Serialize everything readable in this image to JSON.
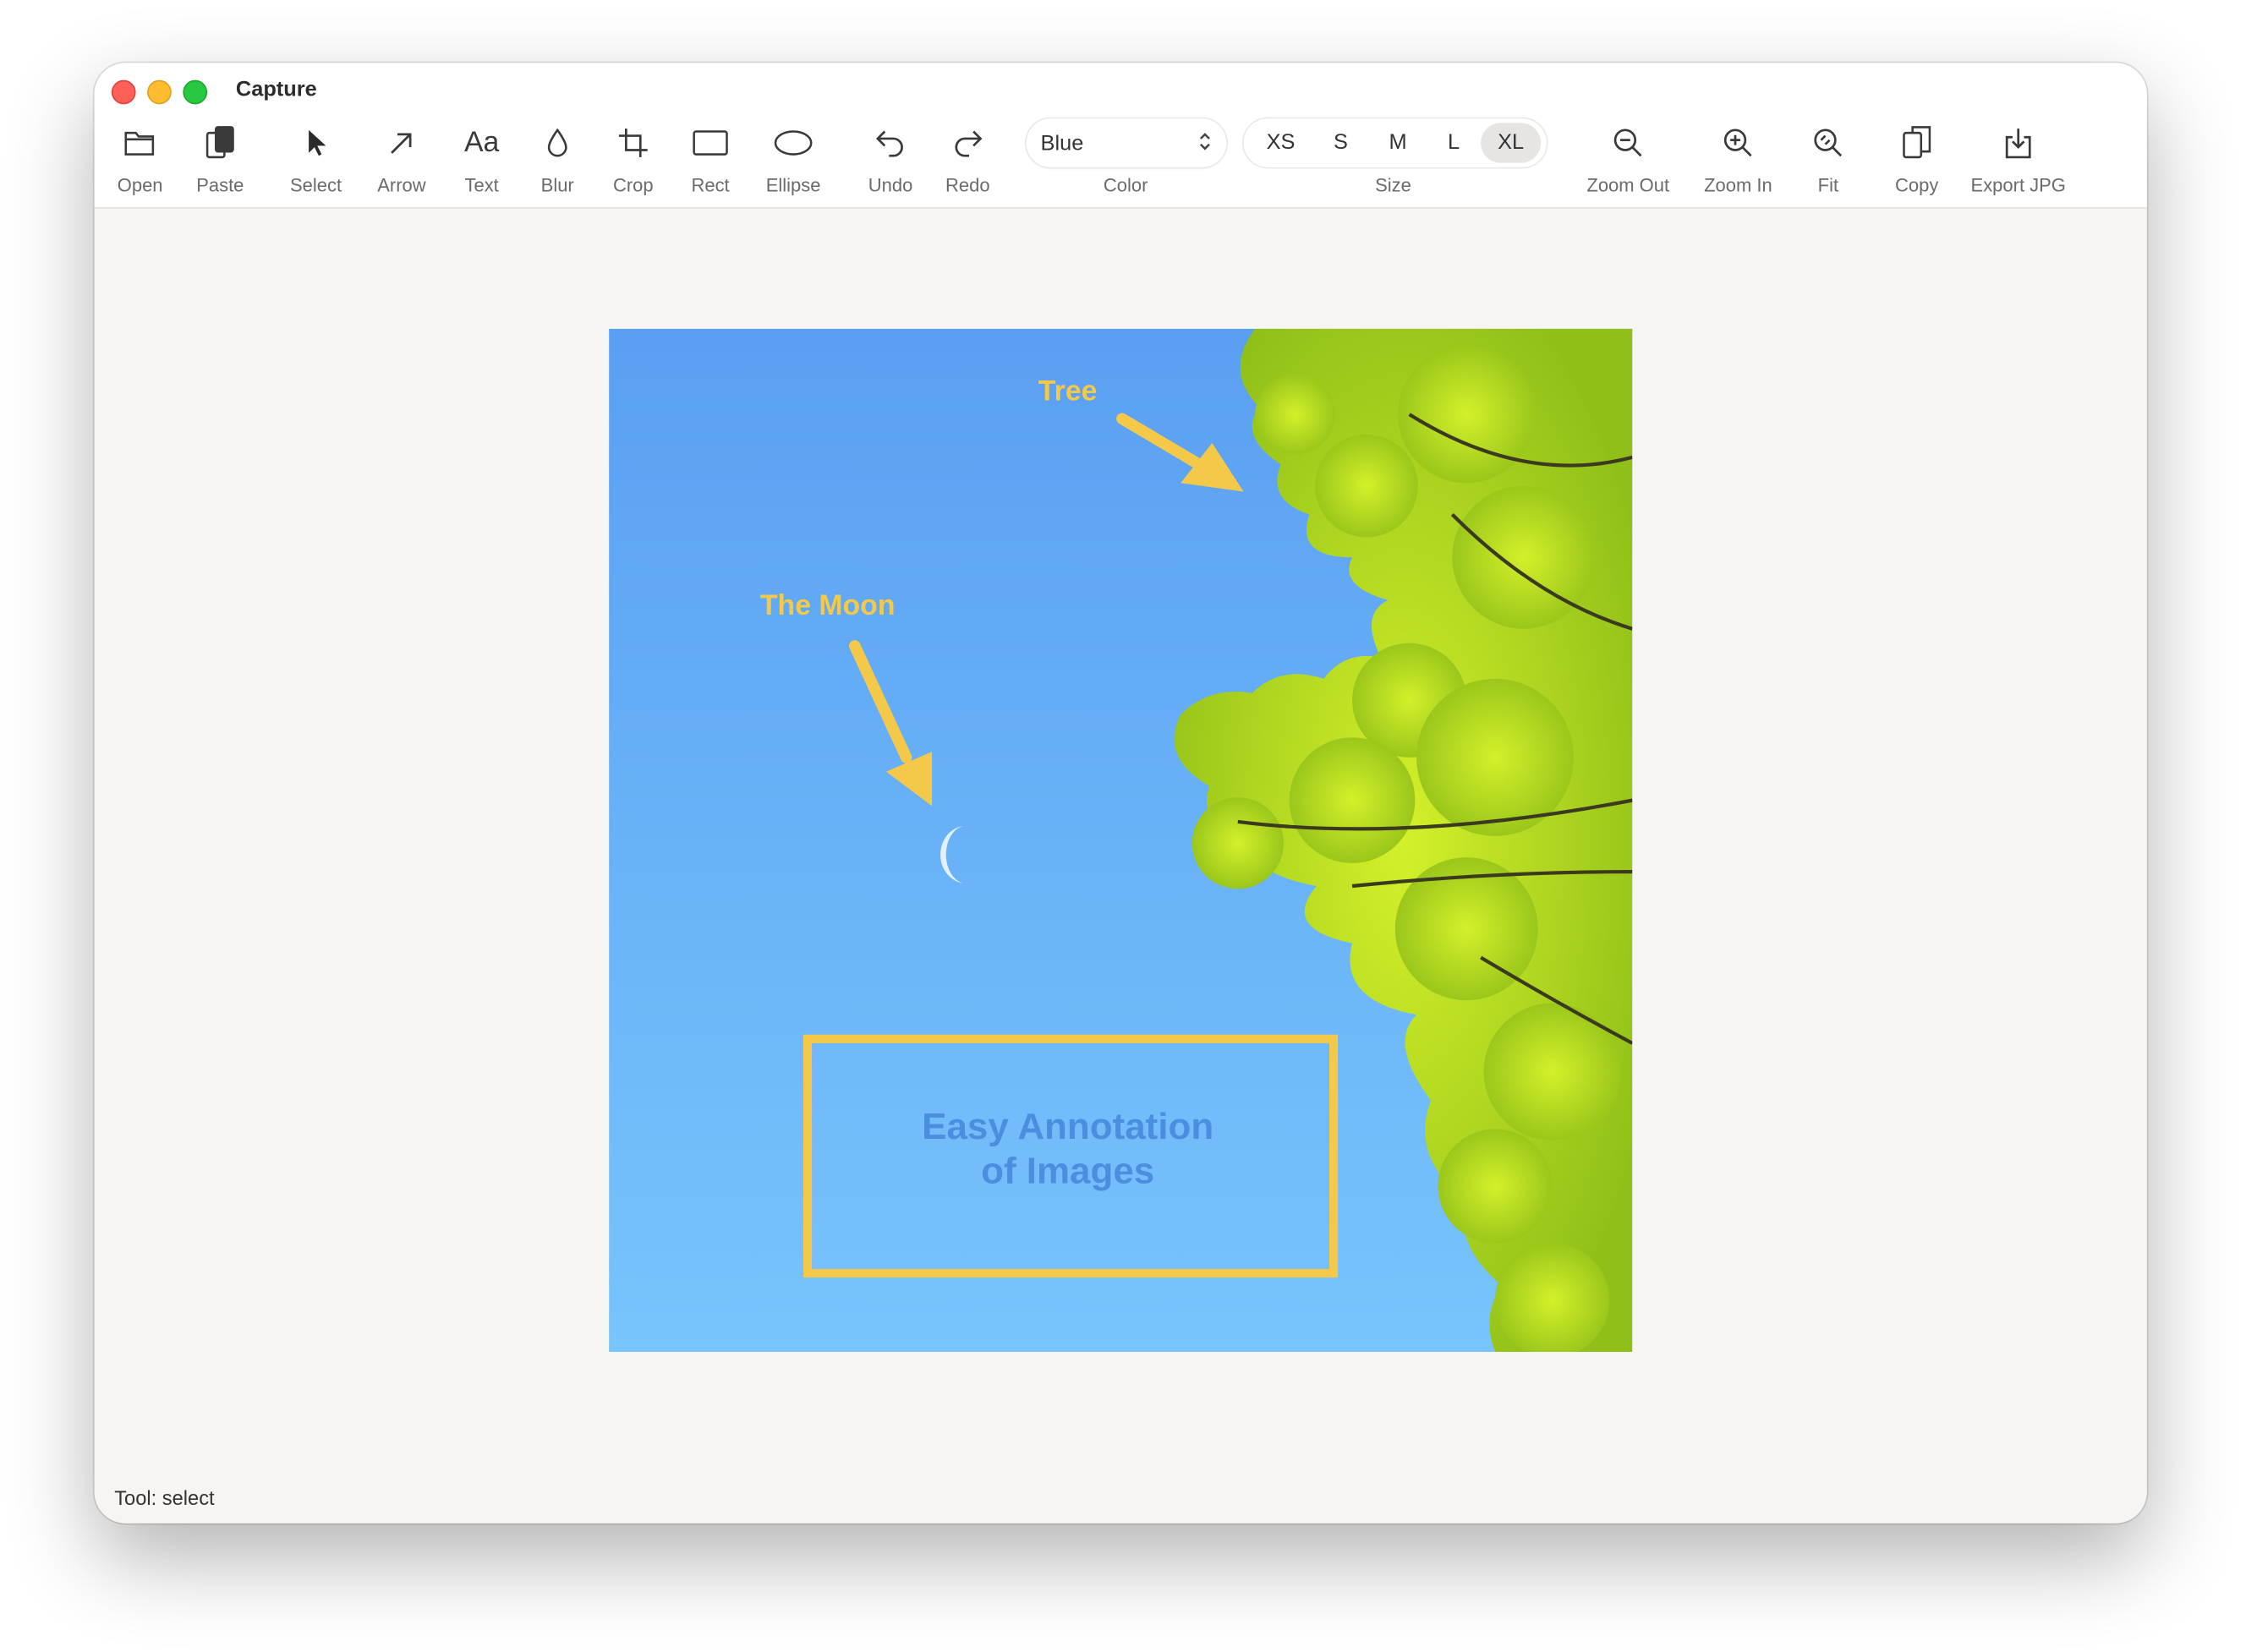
{
  "app": {
    "title": "Capture"
  },
  "toolbar": {
    "open": "Open",
    "paste": "Paste",
    "select": "Select",
    "arrow": "Arrow",
    "text": "Text",
    "text_icon": "Aa",
    "blur": "Blur",
    "crop": "Crop",
    "rect": "Rect",
    "ellipse": "Ellipse",
    "undo": "Undo",
    "redo": "Redo",
    "color_label": "Color",
    "color_value": "Blue",
    "size_label": "Size",
    "sizes": [
      "XS",
      "S",
      "M",
      "L",
      "XL"
    ],
    "size_selected": "XL",
    "zoom_out": "Zoom Out",
    "zoom_in": "Zoom In",
    "fit": "Fit",
    "copy": "Copy",
    "export": "Export JPG"
  },
  "canvas": {
    "annotations": {
      "tree": "Tree",
      "moon": "The Moon",
      "box_line1": "Easy Annotation",
      "box_line2": "of Images"
    },
    "annotation_color": "#f4c94a",
    "box_text_color": "#4a8fdf"
  },
  "status": {
    "text": "Tool: select"
  },
  "icons": [
    "folder-icon",
    "clipboard-icon",
    "cursor-icon",
    "arrow-icon",
    "text-icon",
    "drop-icon",
    "crop-icon",
    "rect-icon",
    "ellipse-icon",
    "undo-icon",
    "redo-icon",
    "zoom-out-icon",
    "zoom-in-icon",
    "fit-icon",
    "copy-icon",
    "export-icon"
  ]
}
